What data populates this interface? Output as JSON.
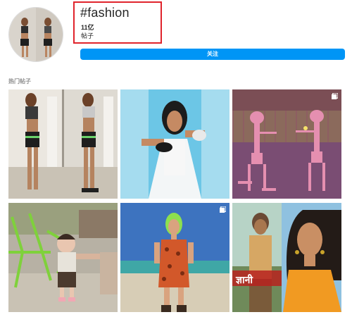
{
  "header": {
    "tag": "#fashion",
    "post_count": "11亿",
    "post_label": "帖子",
    "follow_label": "关注"
  },
  "section": {
    "title": "热门帖子"
  },
  "posts": [
    {
      "subject": "woman mirror selfie workout outfit",
      "multi": false
    },
    {
      "subject": "woman in white hood with sunglasses",
      "multi": false
    },
    {
      "subject": "pink panther cartoon",
      "multi": true
    },
    {
      "subject": "toddler on patio with green chairs",
      "multi": false
    },
    {
      "subject": "woman with green hair on beach",
      "multi": true
    },
    {
      "subject": "tv drama poster",
      "multi": false
    }
  ],
  "poster_text": "ज्ञानी",
  "colors": {
    "accent": "#0095f6",
    "highlight": "#e0242c"
  }
}
